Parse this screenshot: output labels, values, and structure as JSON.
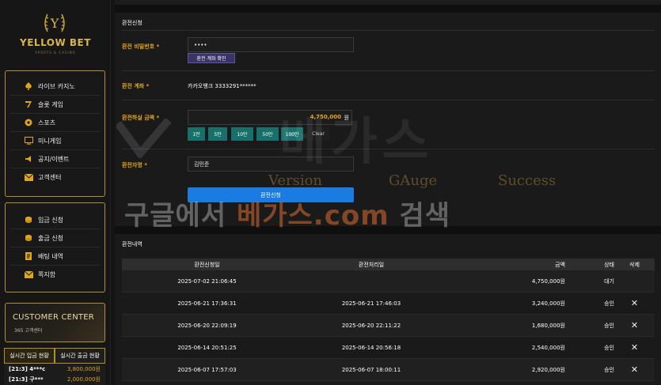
{
  "brand": {
    "name": "YELLOW BET",
    "tagline": "SPORTS & CASINO",
    "letter": "Y"
  },
  "sidebar": {
    "menu1": [
      {
        "label": "라이브 카지노",
        "icon": "spade-icon"
      },
      {
        "label": "슬롯 게임",
        "icon": "slot-seven-icon"
      },
      {
        "label": "스포츠",
        "icon": "soccer-ball-icon"
      },
      {
        "label": "미니게임",
        "icon": "monitor-icon"
      },
      {
        "label": "공지/이벤트",
        "icon": "megaphone-icon"
      },
      {
        "label": "고객센터",
        "icon": "envelope-icon"
      }
    ],
    "menu2": [
      {
        "label": "입금 신청",
        "icon": "coin-stack-icon"
      },
      {
        "label": "출금 신청",
        "icon": "coin-stack-icon"
      },
      {
        "label": "배팅 내역",
        "icon": "document-icon"
      },
      {
        "label": "쪽지함",
        "icon": "envelope-icon"
      }
    ],
    "customer_center": {
      "title": "CUSTOMER CENTER",
      "sub": "365 고객센터"
    },
    "realtime": {
      "tabs": [
        "실시간 입금 현황",
        "실시간 출금 현황"
      ],
      "rows": [
        {
          "name": "[21:3] 4***c",
          "amount": "3,800,000원"
        },
        {
          "name": "[21:3] 구***",
          "amount": "2,000,000원"
        }
      ]
    }
  },
  "form": {
    "title": "환전신청",
    "password_label": "환전 비밀번호 *",
    "password_value": "••••",
    "confirm_button": "환전 계좌 확인",
    "account_label": "환전 계좌 *",
    "account_value": "카카오뱅크 3333291******",
    "amount_label": "환전하실 금액 *",
    "amount_value": "4,750,000",
    "amount_unit": "원",
    "quick_buttons": [
      "1만",
      "5만",
      "10만",
      "50만",
      "100만",
      "Clear"
    ],
    "holder_label": "환전자명 *",
    "holder_value": "김민준",
    "submit": "환전신청"
  },
  "history": {
    "title": "환전내역",
    "columns": [
      "환전신청일",
      "환전처리일",
      "금액",
      "상태",
      "삭제"
    ],
    "rows": [
      {
        "requested": "2025-07-02 21:06:45",
        "processed": "",
        "amount": "4,750,000원",
        "status": "대기",
        "deletable": false
      },
      {
        "requested": "2025-06-21 17:36:31",
        "processed": "2025-06-21 17:46:03",
        "amount": "3,240,000원",
        "status": "승인",
        "deletable": true
      },
      {
        "requested": "2025-06-20 22:09:19",
        "processed": "2025-06-20 22:11:22",
        "amount": "1,680,000원",
        "status": "승인",
        "deletable": true
      },
      {
        "requested": "2025-06-14 20:51:25",
        "processed": "2025-06-14 20:56:18",
        "amount": "2,540,000원",
        "status": "승인",
        "deletable": true
      },
      {
        "requested": "2025-06-07 17:57:03",
        "processed": "2025-06-07 18:00:11",
        "amount": "2,920,000원",
        "status": "승인",
        "deletable": true
      }
    ],
    "delete_glyph": "✕"
  },
  "watermark": {
    "big": "베가스",
    "words": [
      "Version",
      "GAuge",
      "Success"
    ],
    "line_pre": "구글에서 ",
    "line_hl": "베가스.com",
    "line_post": " 검색"
  },
  "colors": {
    "accent": "#e0a41d",
    "gold_border": "#b0902e",
    "submit": "#1a7be0",
    "quick": "#17706b"
  }
}
